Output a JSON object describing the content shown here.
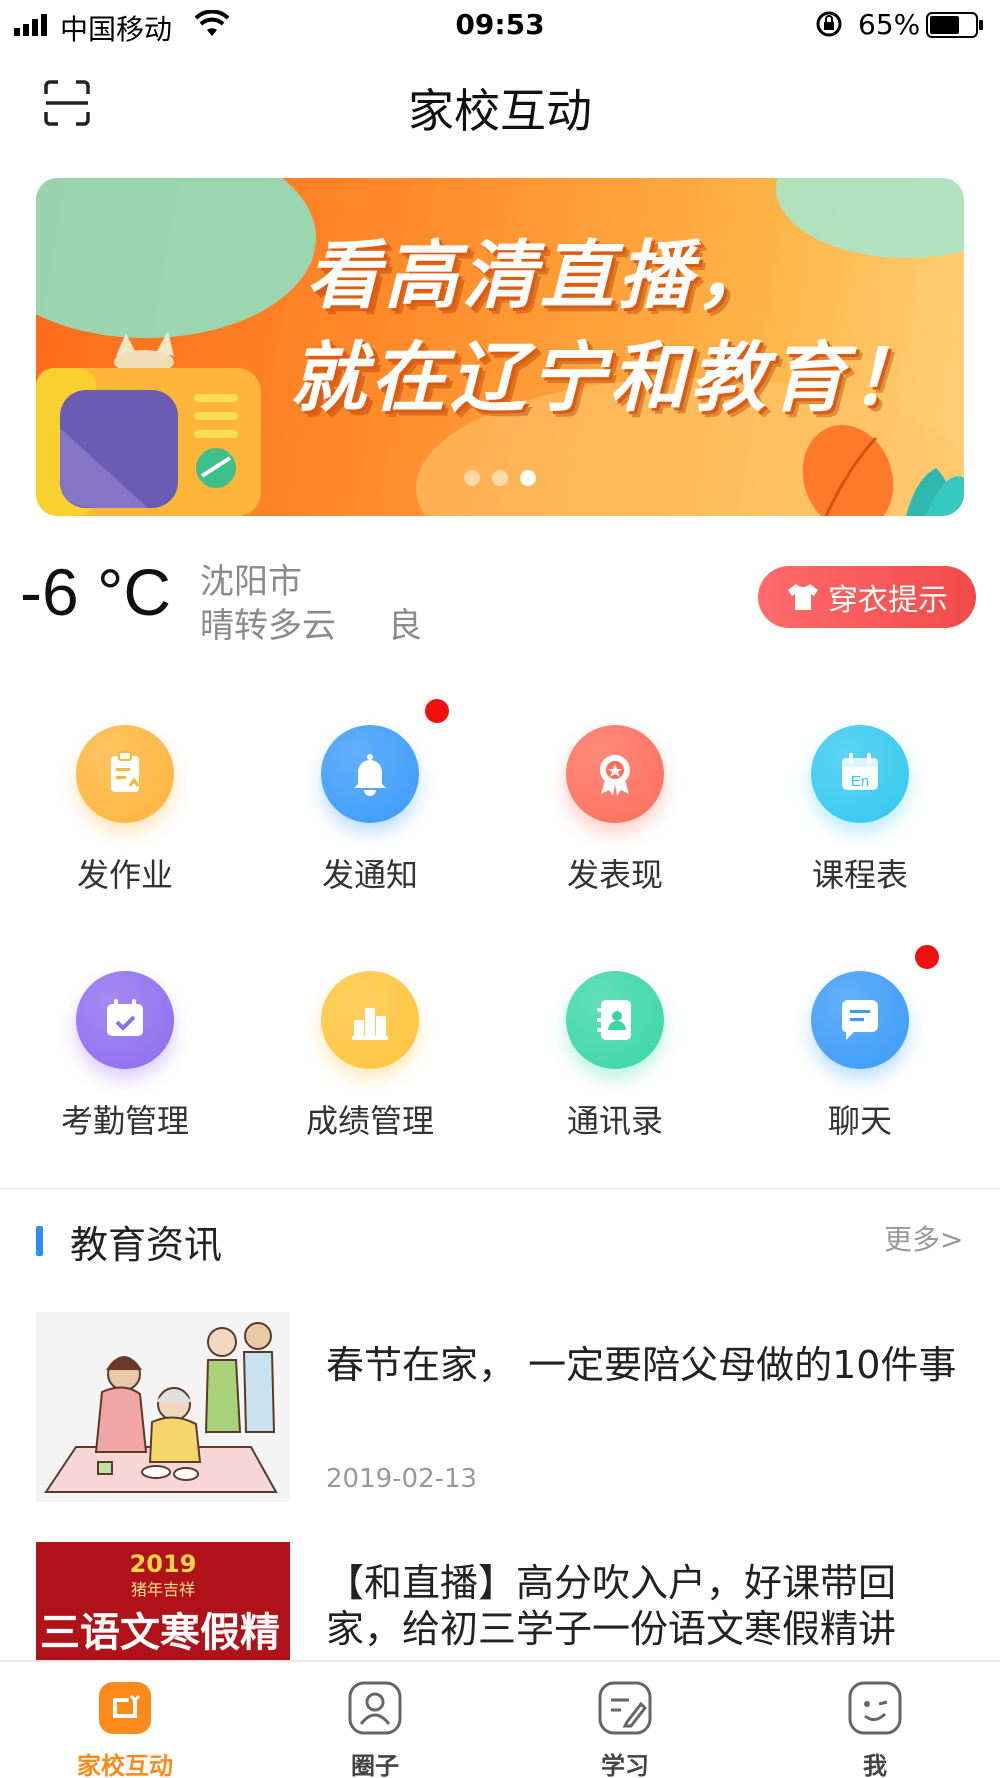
{
  "status_bar": {
    "carrier": "中国移动",
    "time": "09:53",
    "battery_percent": "65%",
    "battery_level": 0.65
  },
  "header": {
    "title": "家校互动",
    "scan_icon": "scan-icon"
  },
  "banner": {
    "line1": "看高清直播，",
    "line2": "就在辽宁和教育！",
    "slide_count": 3,
    "active_slide": 3
  },
  "weather": {
    "temperature": "-6 °C",
    "city": "沈阳市",
    "condition": "晴转多云",
    "air_quality": "良",
    "dress_button": "穿衣提示"
  },
  "features": [
    {
      "label": "发作业",
      "icon": "homework-icon",
      "color": "#ffb43a",
      "badge": false
    },
    {
      "label": "发通知",
      "icon": "bell-icon",
      "color": "#3b9bfa",
      "badge": true
    },
    {
      "label": "发表现",
      "icon": "medal-icon",
      "color": "#ff6d5a",
      "badge": false
    },
    {
      "label": "课程表",
      "icon": "calendar-en-icon",
      "color": "#33c8f0",
      "badge": false
    },
    {
      "label": "考勤管理",
      "icon": "attendance-icon",
      "color": "#8f6cf0",
      "badge": false
    },
    {
      "label": "成绩管理",
      "icon": "podium-icon",
      "color": "#ffc43a",
      "badge": false
    },
    {
      "label": "通讯录",
      "icon": "contacts-icon",
      "color": "#3ad6a6",
      "badge": false
    },
    {
      "label": "聊天",
      "icon": "chat-icon",
      "color": "#3b9bfa",
      "badge": true
    }
  ],
  "news": {
    "section_title": "教育资讯",
    "more_label": "更多>",
    "items": [
      {
        "headline": "春节在家， 一定要陪父母做的10件事",
        "date": "2019-02-13"
      },
      {
        "headline": "【和直播】高分吹入户，好课带回家，给初三学子一份语文寒假精讲",
        "date": ""
      }
    ],
    "thumb2_text": {
      "year": "2019",
      "subtitle": "猪年吉祥",
      "title": "三语文寒假精"
    }
  },
  "tabs": [
    {
      "label": "家校互动",
      "icon": "home-school-icon",
      "active": true
    },
    {
      "label": "圈子",
      "icon": "person-icon",
      "active": false
    },
    {
      "label": "学习",
      "icon": "edit-icon",
      "active": false
    },
    {
      "label": "我",
      "icon": "smile-icon",
      "active": false
    }
  ],
  "colors": {
    "accent_orange": "#ff8a1c",
    "accent_blue": "#2a8ff7",
    "dress_red": "#f24a4a"
  }
}
